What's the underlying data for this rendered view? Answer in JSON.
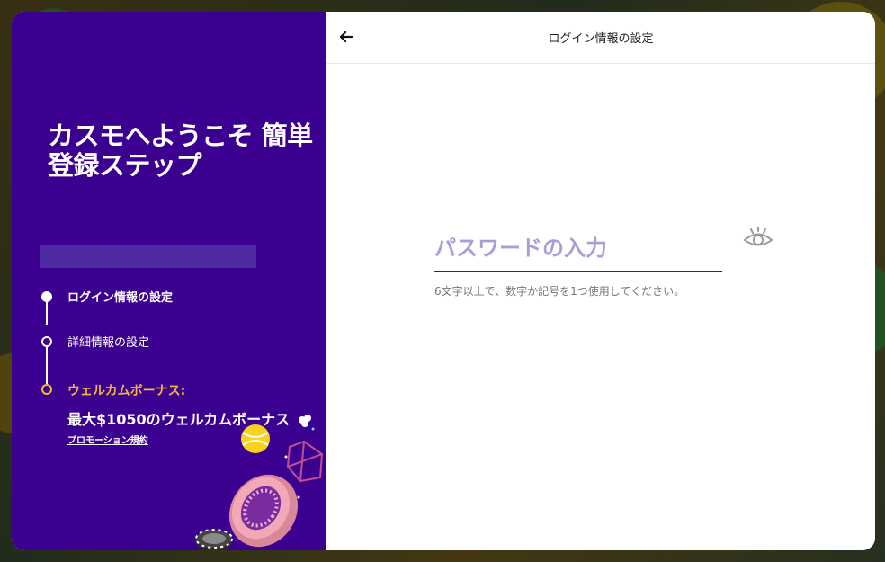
{
  "left_panel": {
    "title": "カスモへようこそ 簡単登録ステップ",
    "steps": [
      {
        "label": "ログイン情報の設定",
        "state": "active"
      },
      {
        "label": "詳細情報の設定",
        "state": "pending"
      },
      {
        "label": "ウェルカムボーナス:",
        "state": "bonus"
      }
    ],
    "bonus_text": "最大$1050のウェルカムボーナス",
    "promo_link": "プロモーション規約"
  },
  "header": {
    "back_icon": "arrow-left-icon",
    "title": "ログイン情報の設定"
  },
  "form": {
    "password": {
      "value": "",
      "placeholder": "パスワードの入力",
      "toggle_icon": "eye-icon"
    },
    "helper_text": "6文字以上で、数字か記号を1つ使用してください。"
  },
  "colors": {
    "brand_purple": "#3b0090",
    "accent_yellow": "#f5b83a",
    "input_underline": "#4b0fa8",
    "placeholder": "#a99fd6"
  }
}
